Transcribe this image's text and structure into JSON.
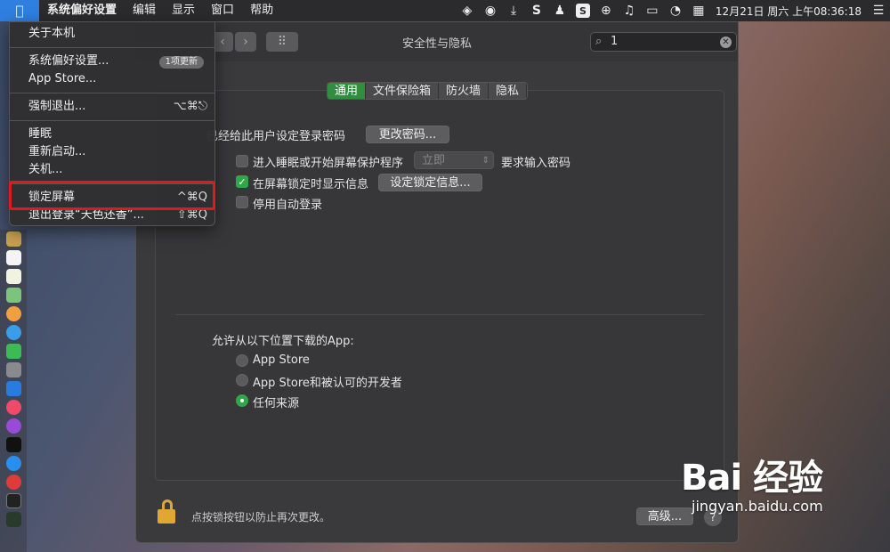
{
  "menubar": {
    "apple_icon": "apple-logo",
    "items": [
      "系统偏好设置",
      "编辑",
      "显示",
      "窗口",
      "帮助"
    ],
    "clock": "12月21日 周六 上午08:36:18"
  },
  "apple_menu": {
    "about": "关于本机",
    "system_prefs": "系统偏好设置...",
    "update_badge": "1项更新",
    "app_store": "App Store...",
    "force_quit": "强制退出...",
    "force_quit_shortcut": "⌥⌘⎋",
    "sleep": "睡眠",
    "restart": "重新启动...",
    "shutdown": "关机...",
    "lock_screen": "锁定屏幕",
    "lock_shortcut": "^⌘Q",
    "logout": "退出登录“天色还香”...",
    "logout_shortcut": "⇧⌘Q"
  },
  "window": {
    "title": "安全性与隐私",
    "search_value": "1",
    "tabs": [
      "通用",
      "文件保险箱",
      "防火墙",
      "隐私"
    ],
    "active_tab": "通用",
    "password_set": "已经给此用户设定登录密码",
    "change_password": "更改密码...",
    "require_password": "进入睡眠或开始屏幕保护程序",
    "require_select": "立即",
    "require_suffix": "要求输入密码",
    "show_message": "在屏幕锁定时显示信息",
    "set_lock_message": "设定锁定信息...",
    "disable_autologin": "停用自动登录",
    "allow_apps_label": "允许从以下位置下载的App:",
    "radio_options": [
      "App Store",
      "App Store和被认可的开发者",
      "任何来源"
    ],
    "radio_selected": "任何来源",
    "lock_text": "点按锁按钮以防止再次更改。",
    "advanced": "高级...",
    "help": "?"
  },
  "watermark": {
    "brand": "Bai 经验",
    "url": "jingyan.baidu.com"
  },
  "colors": {
    "accent_green": "#2fa84a",
    "highlight_red": "#e01a1a",
    "menu_blue": "#2f7fe0"
  }
}
